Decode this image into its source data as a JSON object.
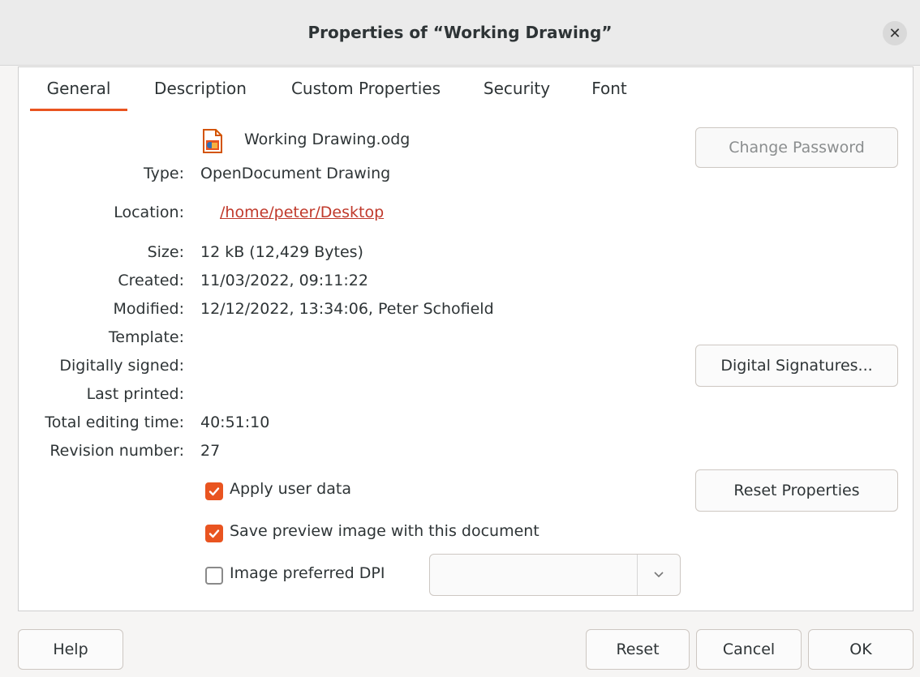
{
  "window": {
    "title": "Properties of “Working Drawing”"
  },
  "tabs": [
    "General",
    "Description",
    "Custom Properties",
    "Security",
    "Font"
  ],
  "general": {
    "file_name": "Working Drawing.odg",
    "labels": {
      "type": "Type:",
      "location": "Location:",
      "size": "Size:",
      "created": "Created:",
      "modified": "Modified:",
      "template": "Template:",
      "digitally_signed": "Digitally signed:",
      "last_printed": "Last printed:",
      "total_editing_time": "Total editing time:",
      "revision_number": "Revision number:"
    },
    "values": {
      "type": "OpenDocument Drawing",
      "location": "/home/peter/Desktop",
      "size": "12 kB (12,429 Bytes)",
      "created": "11/03/2022, 09:11:22",
      "modified": "12/12/2022, 13:34:06, Peter Schofield",
      "template": "",
      "digitally_signed": "",
      "last_printed": "",
      "total_editing_time": "40:51:10",
      "revision_number": "27"
    },
    "buttons": {
      "change_password": "Change Password",
      "digital_signatures": "Digital Signatures...",
      "reset_properties": "Reset Properties"
    },
    "checkboxes": {
      "apply_user_data": {
        "label": "Apply user data",
        "checked": true
      },
      "save_preview": {
        "label": "Save preview image with this document",
        "checked": true
      },
      "image_dpi": {
        "label": "Image preferred DPI",
        "checked": false
      }
    },
    "dpi_value": ""
  },
  "footer": {
    "help": "Help",
    "reset": "Reset",
    "cancel": "Cancel",
    "ok": "OK"
  },
  "colors": {
    "accent": "#e95420",
    "link": "#c0392b"
  },
  "icons": {
    "close": "close-icon",
    "file": "odg-file-icon",
    "check": "check-icon",
    "chevron": "chevron-down-icon"
  }
}
